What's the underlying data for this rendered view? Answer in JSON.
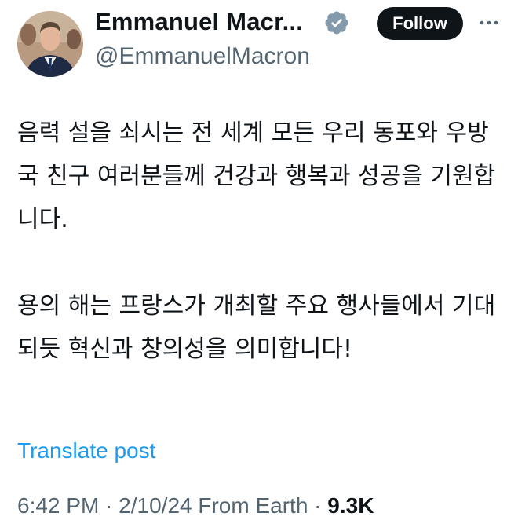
{
  "author": {
    "name": "Emmanuel Macr...",
    "handle": "@EmmanuelMacron",
    "verified": true,
    "avatar": "profile-photo"
  },
  "actions": {
    "follow_label": "Follow",
    "more_icon": "more-options-icon"
  },
  "tweet": {
    "paragraphs": [
      "음력 설을 쇠시는 전 세계 모든 우리 동포와 우방국 친구 여러분들께 건강과 행복과 성공을 기원합니다.",
      "용의 해는 프랑스가 개최할 주요 행사들에서 기대되듯 혁신과 창의성을 의미합니다!"
    ],
    "translate_label": "Translate post"
  },
  "meta": {
    "time": "6:42 PM",
    "separator": " · ",
    "date": "2/10/24",
    "source": "From Earth",
    "views": "9.3K"
  },
  "colors": {
    "text": "#0f1419",
    "secondary": "#536471",
    "link": "#1d9bf0",
    "button": "#0f1419"
  }
}
